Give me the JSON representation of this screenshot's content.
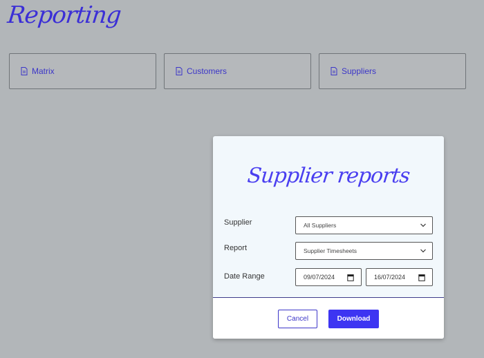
{
  "page": {
    "title": "Reporting"
  },
  "cards": [
    {
      "label": "Matrix",
      "icon": "document-icon"
    },
    {
      "label": "Customers",
      "icon": "document-icon"
    },
    {
      "label": "Suppliers",
      "icon": "document-icon"
    }
  ],
  "modal": {
    "title": "Supplier reports",
    "supplier": {
      "label": "Supplier",
      "value": "All Suppliers"
    },
    "report": {
      "label": "Report",
      "value": "Supplier Timesheets"
    },
    "date_range": {
      "label": "Date Range",
      "start": "09/07/2024",
      "end": "16/07/2024"
    },
    "cancel_label": "Cancel",
    "download_label": "Download"
  },
  "colors": {
    "accent": "#3d35f2",
    "background": "#b2b6b9",
    "modal_bg": "#f2f8fc"
  }
}
